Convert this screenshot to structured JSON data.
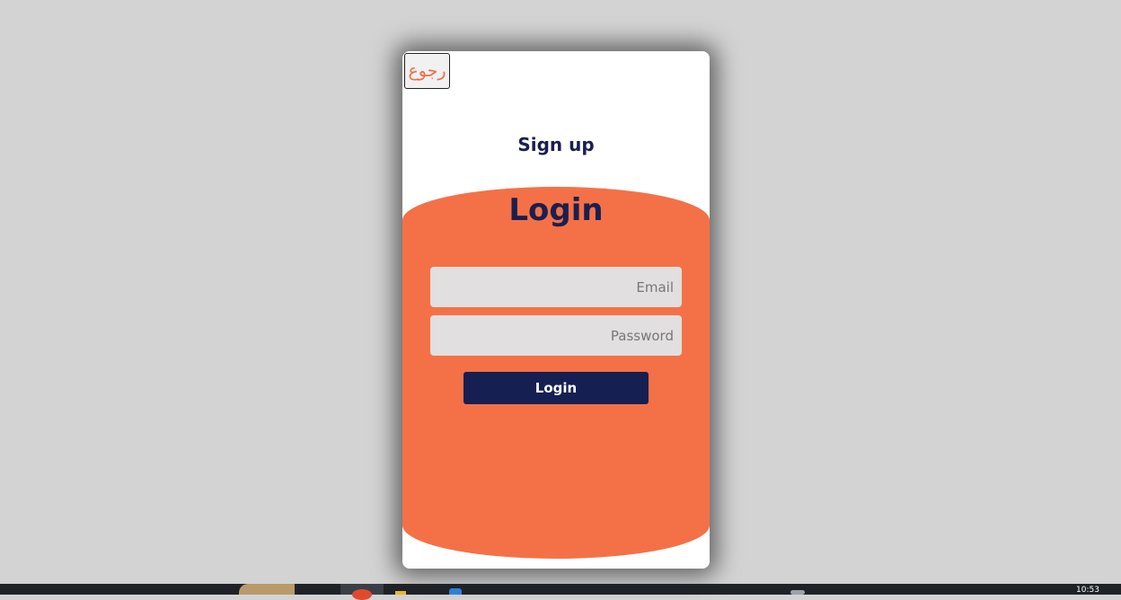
{
  "card": {
    "back_label": "رجوع",
    "signup_label": "Sign up",
    "login_title": "Login",
    "email_placeholder": "Email",
    "password_placeholder": "Password",
    "login_button_label": "Login"
  },
  "taskbar": {
    "clock": "10:53"
  },
  "colors": {
    "background": "#d3d3d3",
    "accent": "#f47147",
    "navy": "#151f52",
    "field": "#e1dfdf"
  }
}
